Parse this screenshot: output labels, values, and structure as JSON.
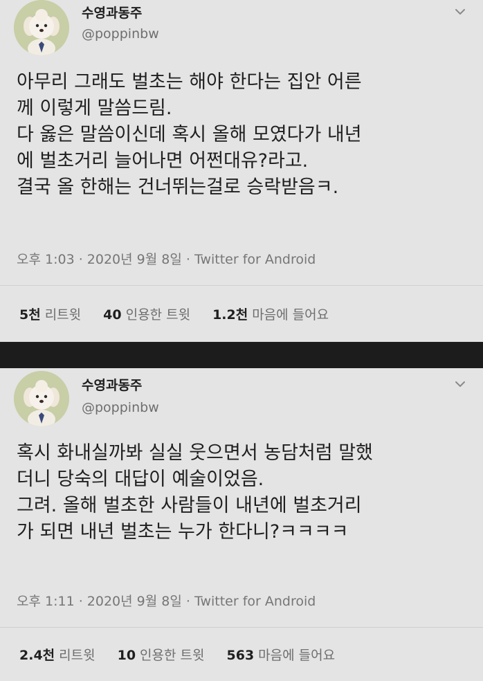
{
  "tweets": [
    {
      "author": {
        "name": "수영과동주",
        "handle": "@poppinbw"
      },
      "body": [
        "아무리 그래도 벌초는 해야 한다는 집안 어른",
        "께 이렇게 말씀드림.",
        "다 옳은 말씀이신데 혹시 올해 모였다가 내년",
        "에 벌초거리 늘어나면 어쩐대유?라고.",
        "결국 올 한해는 건너뛰는걸로 승락받음ㅋ."
      ],
      "time": "오후 1:03",
      "date": "2020년 9월 8일",
      "source": "Twitter for Android",
      "stats": [
        {
          "num": "5천",
          "label": "리트윗"
        },
        {
          "num": "40",
          "label": "인용한 트윗"
        },
        {
          "num": "1.2천",
          "label": "마음에 들어요"
        }
      ]
    },
    {
      "author": {
        "name": "수영과동주",
        "handle": "@poppinbw"
      },
      "body": [
        "혹시 화내실까봐 실실 웃으면서 농담처럼 말했",
        "더니 당숙의 대답이 예술이었음.",
        "그려. 올해 벌초한 사람들이 내년에 벌초거리",
        "가 되면 내년 벌초는 누가 한다니?ㅋㅋㅋㅋ"
      ],
      "time": "오후 1:11",
      "date": "2020년 9월 8일",
      "source": "Twitter for Android",
      "stats": [
        {
          "num": "2.4천",
          "label": "리트윗"
        },
        {
          "num": "10",
          "label": "인용한 트윗"
        },
        {
          "num": "563",
          "label": "마음에 들어요"
        }
      ]
    }
  ],
  "separator": " · ",
  "icons": {
    "menu": "chevron-down-icon",
    "avatar": "dog-avatar"
  },
  "colors": {
    "card": "#e4e4e4",
    "gap": "#1c1c1c",
    "muted": "#767676",
    "text": "#1f1f1f"
  }
}
